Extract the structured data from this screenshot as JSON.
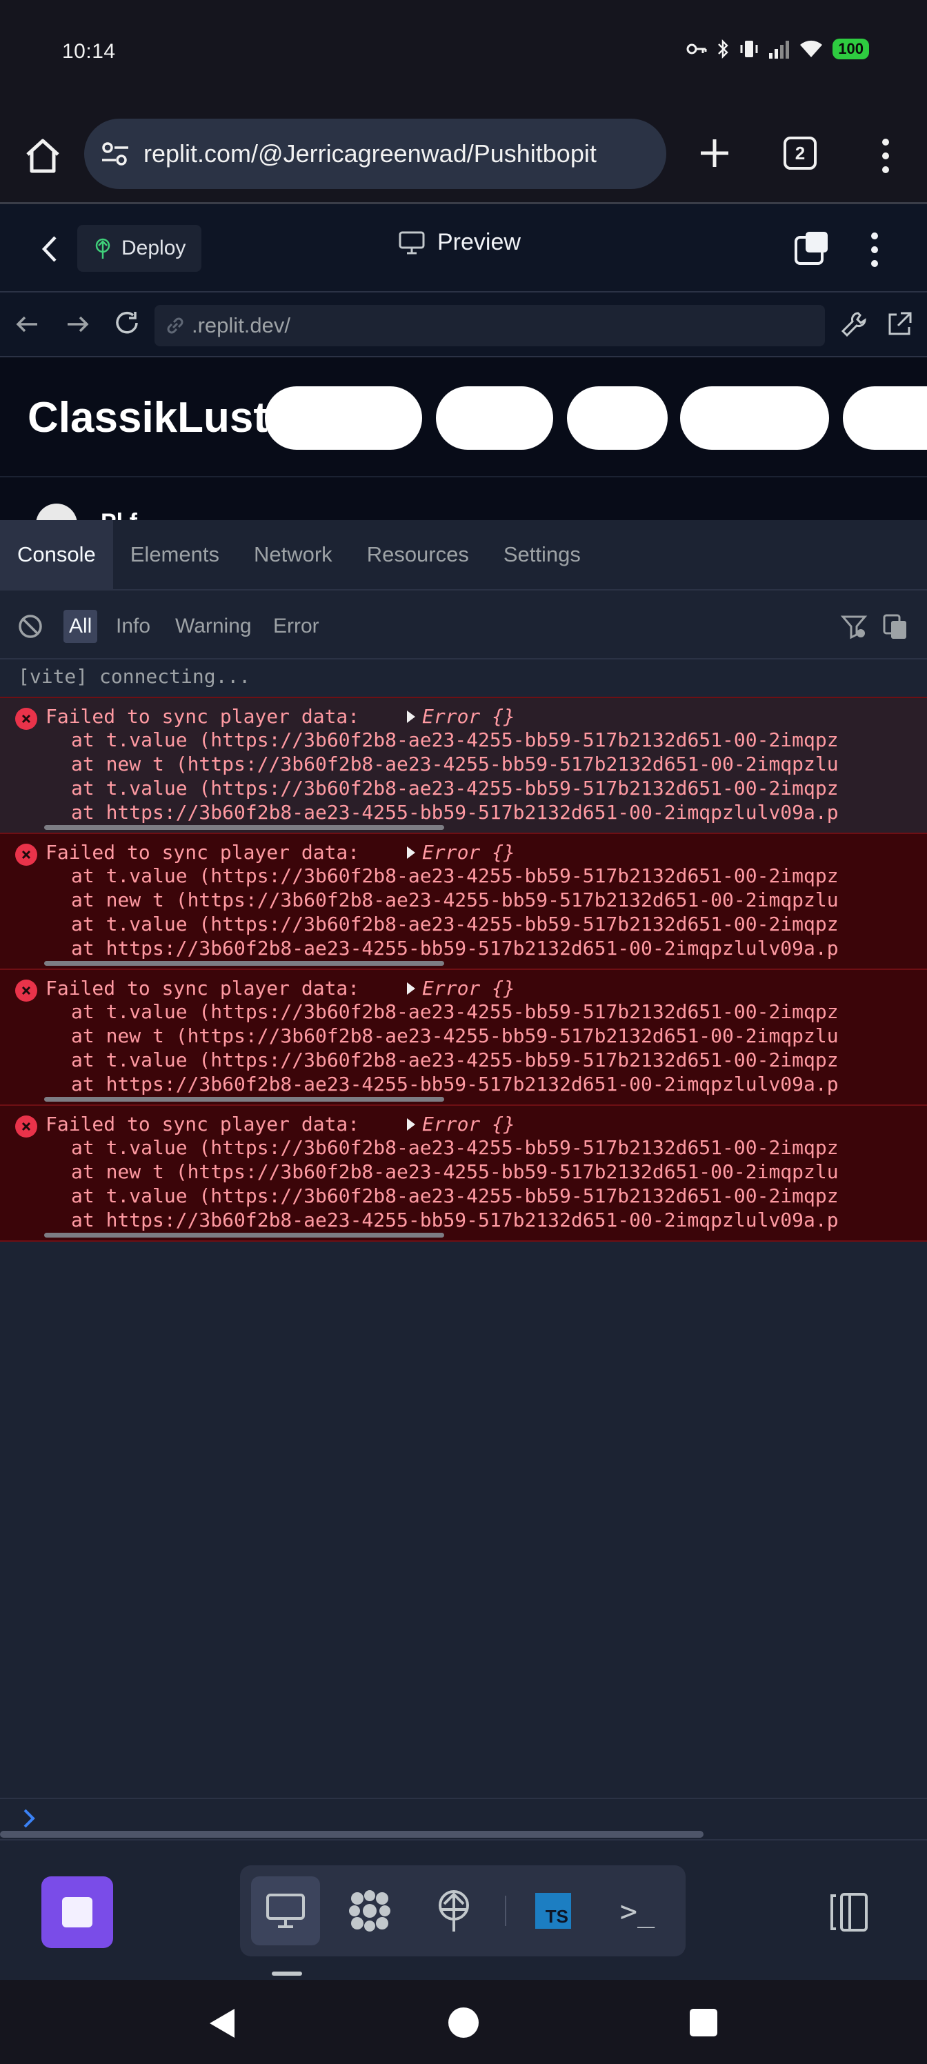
{
  "status_bar": {
    "time": "10:14",
    "battery": "100"
  },
  "browser": {
    "url": "replit.com/@Jerricagreenwad/Pushitbopit",
    "tab_count": "2"
  },
  "replit_header": {
    "deploy_label": "Deploy",
    "preview_label": "Preview"
  },
  "preview_nav": {
    "url": ".replit.dev/"
  },
  "site": {
    "logo": "ClassikLust",
    "peek_text": "Pl  f"
  },
  "devtools": {
    "tabs": [
      "Console",
      "Elements",
      "Network",
      "Resources",
      "Settings"
    ],
    "levels": [
      "All",
      "Info",
      "Warning",
      "Error"
    ]
  },
  "console": {
    "log": "[vite] connecting...",
    "errors": [
      {
        "message": "Failed to sync player data:",
        "object": "Error {}",
        "stack": [
          "at t.value (https://3b60f2b8-ae23-4255-bb59-517b2132d651-00-2imqpz",
          "at new t (https://3b60f2b8-ae23-4255-bb59-517b2132d651-00-2imqpzlu",
          "at t.value (https://3b60f2b8-ae23-4255-bb59-517b2132d651-00-2imqpz",
          "at https://3b60f2b8-ae23-4255-bb59-517b2132d651-00-2imqpzlulv09a.p"
        ]
      },
      {
        "message": "Failed to sync player data:",
        "object": "Error {}",
        "stack": [
          "at t.value (https://3b60f2b8-ae23-4255-bb59-517b2132d651-00-2imqpz",
          "at new t (https://3b60f2b8-ae23-4255-bb59-517b2132d651-00-2imqpzlu",
          "at t.value (https://3b60f2b8-ae23-4255-bb59-517b2132d651-00-2imqpz",
          "at https://3b60f2b8-ae23-4255-bb59-517b2132d651-00-2imqpzlulv09a.p"
        ]
      },
      {
        "message": "Failed to sync player data:",
        "object": "Error {}",
        "stack": [
          "at t.value (https://3b60f2b8-ae23-4255-bb59-517b2132d651-00-2imqpz",
          "at new t (https://3b60f2b8-ae23-4255-bb59-517b2132d651-00-2imqpzlu",
          "at t.value (https://3b60f2b8-ae23-4255-bb59-517b2132d651-00-2imqpz",
          "at https://3b60f2b8-ae23-4255-bb59-517b2132d651-00-2imqpzlulv09a.p"
        ]
      },
      {
        "message": "Failed to sync player data:",
        "object": "Error {}",
        "stack": [
          "at t.value (https://3b60f2b8-ae23-4255-bb59-517b2132d651-00-2imqpz",
          "at new t (https://3b60f2b8-ae23-4255-bb59-517b2132d651-00-2imqpzlu",
          "at t.value (https://3b60f2b8-ae23-4255-bb59-517b2132d651-00-2imqpz",
          "at https://3b60f2b8-ae23-4255-bb59-517b2132d651-00-2imqpzlulv09a.p"
        ]
      }
    ]
  },
  "toolbar": {
    "ts_label": "TS",
    "terminal_label": ">_"
  },
  "icons": {
    "home": "home-icon",
    "tune": "tune-icon",
    "add": "plus-icon",
    "more": "more-vert-icon",
    "deploy": "deploy-icon",
    "monitor": "monitor-icon",
    "windows": "windows-icon",
    "arrow_back": "arrow-left-icon",
    "arrow_forward": "arrow-right-icon",
    "reload": "reload-icon",
    "link": "link-icon",
    "wrench": "wrench-icon",
    "external": "external-link-icon",
    "clear": "clear-console-icon",
    "filter": "filter-icon",
    "copy": "copy-icon"
  },
  "colors": {
    "accent_stop": "#7a4ce8",
    "error_text": "#ff9aa2",
    "error_icon": "#e9334a",
    "battery": "#2ecc40",
    "prompt": "#3b82f6"
  }
}
